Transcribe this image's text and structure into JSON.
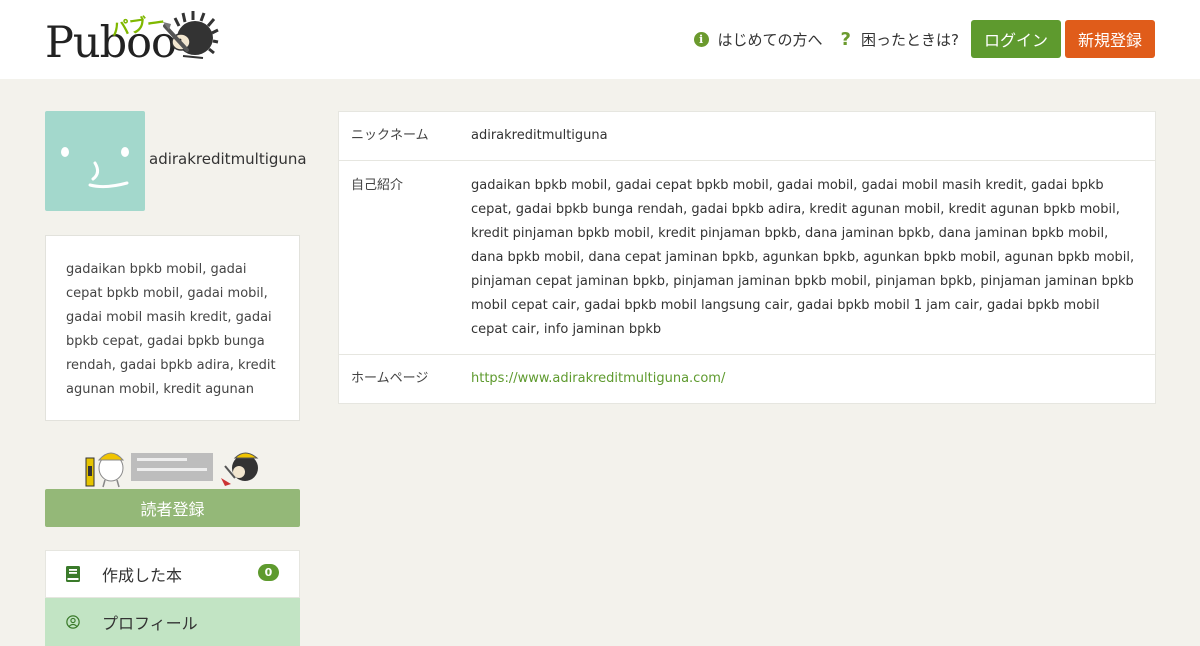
{
  "header": {
    "logo_text": "Puboo",
    "logo_kana": "パブー",
    "nav": {
      "first_time": "はじめての方へ",
      "help": "困ったときは?",
      "login": "ログイン",
      "signup": "新規登録"
    }
  },
  "sidebar": {
    "username": "adirakreditmultiguna",
    "bio": "gadaikan bpkb mobil, gadai cepat bpkb mobil, gadai mobil, gadai mobil masih kredit, gadai bpkb cepat, gadai bpkb bunga rendah, gadai bpkb adira, kredit agunan mobil, kredit agunan bpkb mobil, kredit p...",
    "reader_button": "読者登録",
    "menu": [
      {
        "label": "作成した本",
        "count": "0"
      },
      {
        "label": "プロフィール"
      }
    ]
  },
  "profile": {
    "nickname_label": "ニックネーム",
    "nickname": "adirakreditmultiguna",
    "bio_label": "自己紹介",
    "bio": "gadaikan bpkb mobil, gadai cepat bpkb mobil, gadai mobil, gadai mobil masih kredit, gadai bpkb cepat, gadai bpkb bunga rendah, gadai bpkb adira, kredit agunan mobil, kredit agunan bpkb mobil, kredit pinjaman bpkb mobil, kredit pinjaman bpkb, dana jaminan bpkb, dana jaminan bpkb mobil, dana bpkb mobil, dana cepat jaminan bpkb, agunkan bpkb, agunkan bpkb mobil, agunan bpkb mobil, pinjaman cepat jaminan bpkb, pinjaman jaminan bpkb mobil, pinjaman bpkb, pinjaman jaminan bpkb mobil cepat cair, gadai bpkb mobil langsung cair, gadai bpkb mobil 1 jam cair, gadai bpkb mobil cepat cair, info jaminan bpkb",
    "homepage_label": "ホームページ",
    "homepage": "https://www.adirakreditmultiguna.com/"
  },
  "colors": {
    "accent_green": "#5e9a2e",
    "signup_orange": "#e05c1a",
    "avatar_bg": "#a3d8cc",
    "active_menu": "#c2e4c4"
  },
  "icons": [
    "info-icon",
    "question-icon",
    "hedgehog-logo-icon",
    "book-icon",
    "user-circle-icon"
  ]
}
